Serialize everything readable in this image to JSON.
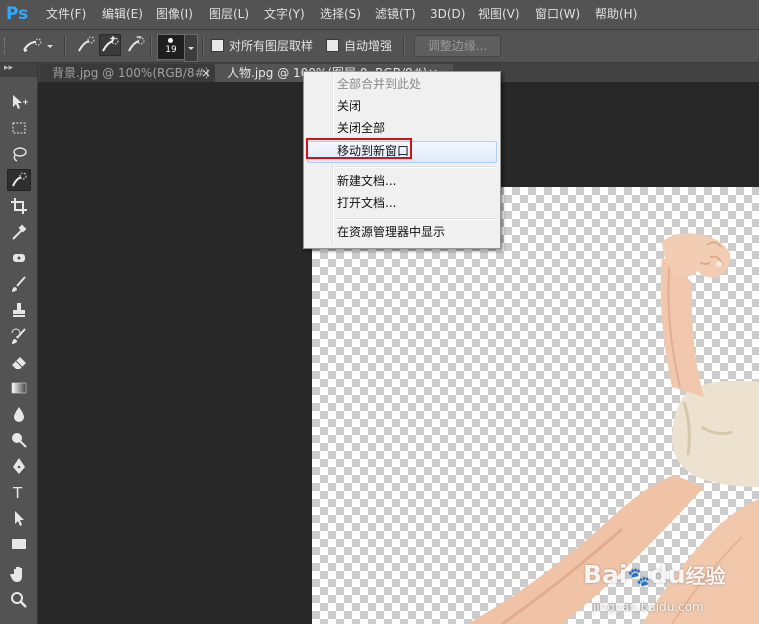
{
  "app": {
    "logo": "Ps"
  },
  "menubar": {
    "items": [
      "文件(F)",
      "编辑(E)",
      "图像(I)",
      "图层(L)",
      "文字(Y)",
      "选择(S)",
      "滤镜(T)",
      "3D(D)",
      "视图(V)",
      "窗口(W)",
      "帮助(H)"
    ]
  },
  "options": {
    "brush_size": "19",
    "sample_all_layers": "对所有图层取样",
    "auto_enhance": "自动增强",
    "refine_edge": "调整边缘..."
  },
  "tabs": [
    {
      "label": "背景.jpg @ 100%(RGB/8#)",
      "close": "×"
    },
    {
      "label": "人物.jpg @ 100%(图层 0, RGB/8#)",
      "close": "×"
    }
  ],
  "context_menu": {
    "items": [
      {
        "label": "全部合并到此处",
        "enabled": false
      },
      {
        "label": "关闭",
        "enabled": true
      },
      {
        "label": "关闭全部",
        "enabled": true
      },
      {
        "label": "移动到新窗口",
        "enabled": true,
        "hovered": true
      },
      {
        "label": "新建文档...",
        "enabled": true
      },
      {
        "label": "打开文档...",
        "enabled": true
      },
      {
        "label": "在资源管理器中显示",
        "enabled": true
      }
    ]
  },
  "toolbar": {
    "tools": [
      "move-tool",
      "marquee-tool",
      "lasso-tool",
      "quick-selection-tool",
      "crop-tool",
      "eyedropper-tool",
      "spot-healing-tool",
      "brush-tool",
      "clone-stamp-tool",
      "history-brush-tool",
      "eraser-tool",
      "gradient-tool",
      "blur-tool",
      "dodge-tool",
      "pen-tool",
      "type-tool",
      "path-selection-tool",
      "rectangle-tool",
      "hand-tool",
      "zoom-tool"
    ],
    "active": "quick-selection-tool"
  },
  "watermark": {
    "brand": "Bai",
    "paw": "du",
    "suffix": "经验",
    "url": "jingyan.baidu.com"
  },
  "colors": {
    "accent": "#31a8ff",
    "highlight": "#d0121b",
    "panel": "#535353",
    "workspace": "#282828"
  }
}
